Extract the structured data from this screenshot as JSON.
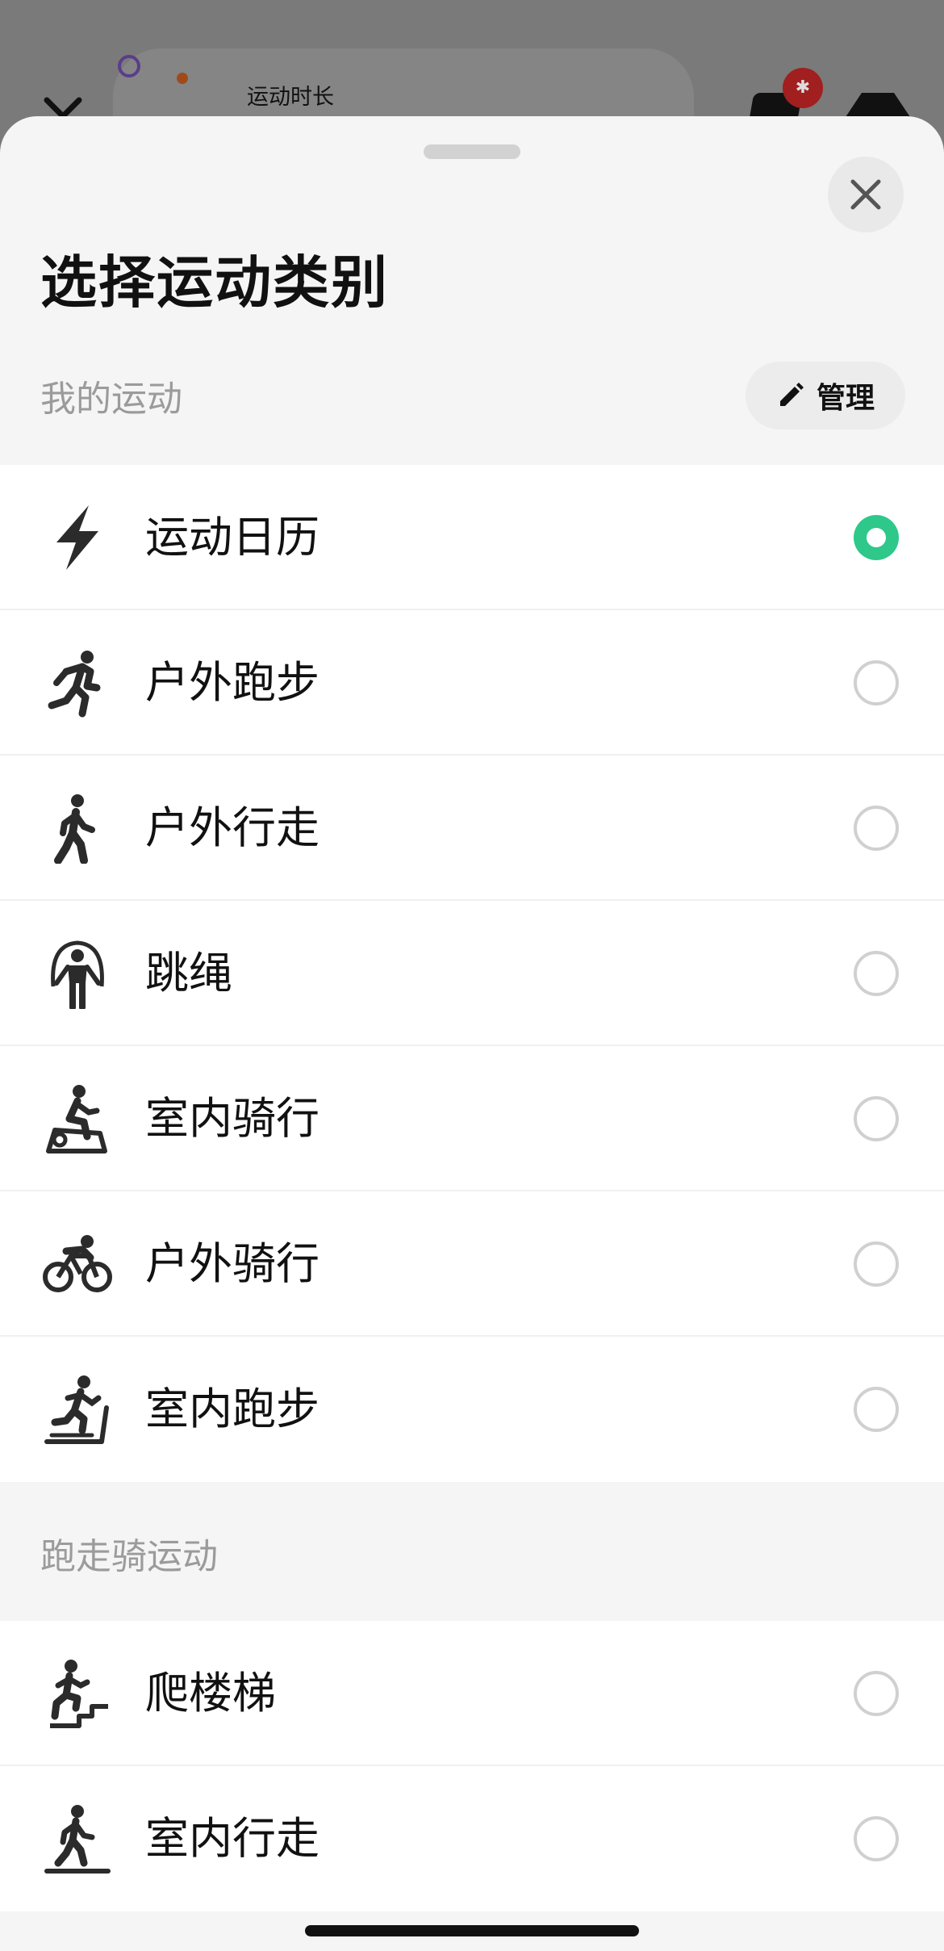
{
  "background": {
    "card_title": "运动时长",
    "badge_icon": "bluetooth-off-icon"
  },
  "sheet": {
    "title": "选择运动类别",
    "close_icon": "close-icon"
  },
  "my_section": {
    "title": "我的运动",
    "manage_label": "管理",
    "manage_icon": "pencil-icon",
    "items": [
      {
        "label": "运动日历",
        "icon": "lightning-icon",
        "selected": true
      },
      {
        "label": "户外跑步",
        "icon": "running-icon",
        "selected": false
      },
      {
        "label": "户外行走",
        "icon": "walking-icon",
        "selected": false
      },
      {
        "label": "跳绳",
        "icon": "jump-rope-icon",
        "selected": false
      },
      {
        "label": "室内骑行",
        "icon": "indoor-cycling-icon",
        "selected": false
      },
      {
        "label": "户外骑行",
        "icon": "outdoor-cycling-icon",
        "selected": false
      },
      {
        "label": "室内跑步",
        "icon": "treadmill-icon",
        "selected": false
      }
    ]
  },
  "run_section": {
    "title": "跑走骑运动",
    "items": [
      {
        "label": "爬楼梯",
        "icon": "stairs-icon",
        "selected": false
      },
      {
        "label": "室内行走",
        "icon": "indoor-walking-icon",
        "selected": false
      }
    ]
  },
  "colors": {
    "accent": "#2ec88a",
    "sheet_bg": "#f5f5f5",
    "scrim": "#7a7a7a"
  }
}
